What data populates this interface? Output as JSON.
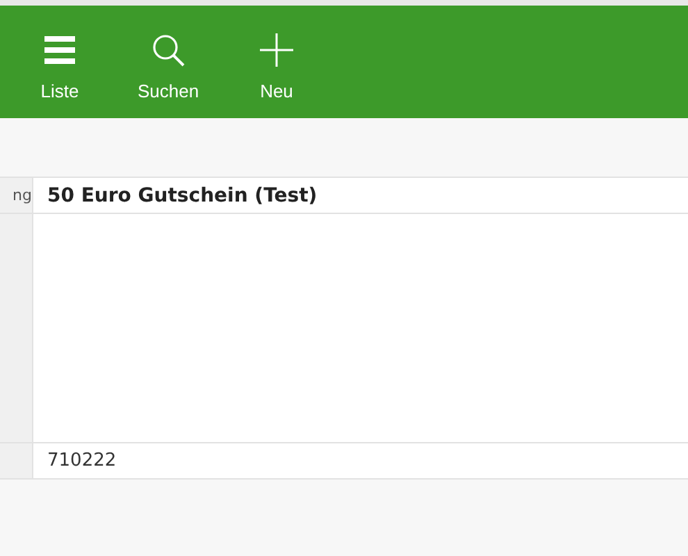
{
  "toolbar": {
    "buttons": [
      {
        "kind": "list",
        "label": "Liste"
      },
      {
        "kind": "search",
        "label": "Suchen"
      },
      {
        "kind": "add",
        "label": "Neu"
      }
    ]
  },
  "table": {
    "rows": [
      {
        "kind": "title",
        "label": "ng",
        "value": "50 Euro Gutschein (Test)"
      },
      {
        "kind": "notes"
      },
      {
        "kind": "text",
        "value": "710222"
      }
    ]
  }
}
